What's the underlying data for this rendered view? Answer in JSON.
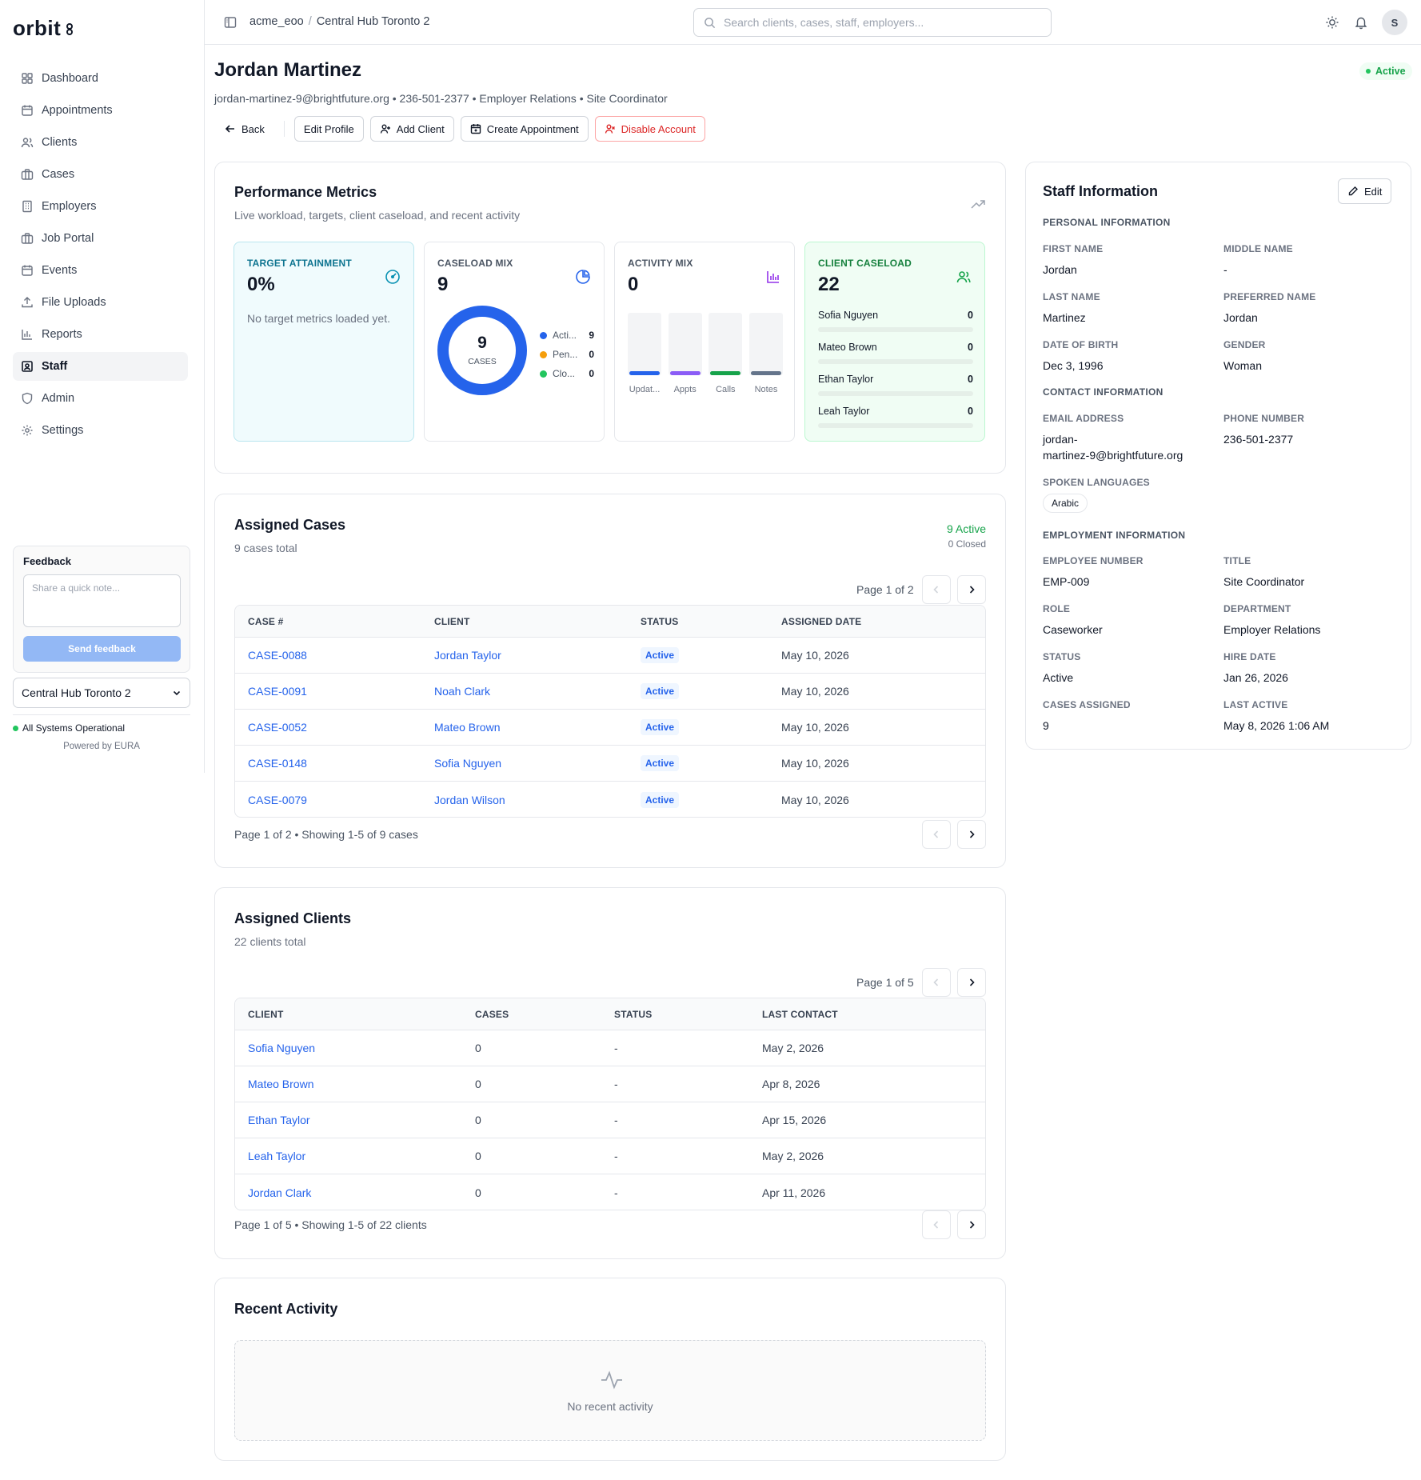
{
  "app": {
    "logo": "orbit"
  },
  "sidebar": {
    "items": [
      {
        "label": "Dashboard",
        "icon": "dashboard-icon"
      },
      {
        "label": "Appointments",
        "icon": "calendar-icon"
      },
      {
        "label": "Clients",
        "icon": "users-icon"
      },
      {
        "label": "Cases",
        "icon": "briefcase-icon"
      },
      {
        "label": "Employers",
        "icon": "building-icon"
      },
      {
        "label": "Job Portal",
        "icon": "briefcase-icon"
      },
      {
        "label": "Events",
        "icon": "calendar-icon"
      },
      {
        "label": "File Uploads",
        "icon": "upload-icon"
      },
      {
        "label": "Reports",
        "icon": "bar-chart-icon"
      },
      {
        "label": "Staff",
        "icon": "id-badge-icon",
        "active": true
      },
      {
        "label": "Admin",
        "icon": "shield-icon"
      },
      {
        "label": "Settings",
        "icon": "gear-icon"
      }
    ],
    "feedback": {
      "title": "Feedback",
      "placeholder": "Share a quick note...",
      "button": "Send feedback"
    },
    "hub": "Central Hub Toronto 2",
    "status": "All Systems Operational",
    "powered": "Powered by EURA"
  },
  "header": {
    "breadcrumb_org": "acme_eoo",
    "breadcrumb_sep": "/",
    "breadcrumb_hub": "Central Hub Toronto 2",
    "search_placeholder": "Search clients, cases, staff, employers...",
    "avatar": "S"
  },
  "profile": {
    "name": "Jordan Martinez",
    "subtitle": "jordan-martinez-9@brightfuture.org • 236-501-2377 • Employer Relations • Site Coordinator",
    "status": "Active",
    "actions": {
      "back": "Back",
      "edit": "Edit Profile",
      "add_client": "Add Client",
      "create_appt": "Create Appointment",
      "disable": "Disable Account"
    }
  },
  "metrics": {
    "title": "Performance Metrics",
    "subtitle": "Live workload, targets, client caseload, and recent activity",
    "target": {
      "label": "Target Attainment",
      "value": "0%",
      "empty": "No target metrics loaded yet."
    },
    "caseload": {
      "label": "Caseload Mix",
      "value": "9",
      "center_value": "9",
      "center_label": "CASES",
      "legend": [
        {
          "label": "Acti...",
          "value": "9",
          "color": "#2563eb"
        },
        {
          "label": "Pen...",
          "value": "0",
          "color": "#f59e0b"
        },
        {
          "label": "Clo...",
          "value": "0",
          "color": "#22c55e"
        }
      ]
    },
    "activity": {
      "label": "Activity Mix",
      "value": "0",
      "bars": [
        {
          "label": "Updat...",
          "color": "#2563eb"
        },
        {
          "label": "Appts",
          "color": "#8b5cf6"
        },
        {
          "label": "Calls",
          "color": "#16a34a"
        },
        {
          "label": "Notes",
          "color": "#64748b"
        }
      ]
    },
    "clients": {
      "label": "Client Caseload",
      "value": "22",
      "rows": [
        {
          "name": "Sofia Nguyen",
          "value": "0"
        },
        {
          "name": "Mateo Brown",
          "value": "0"
        },
        {
          "name": "Ethan Taylor",
          "value": "0"
        },
        {
          "name": "Leah Taylor",
          "value": "0"
        }
      ]
    }
  },
  "cases": {
    "title": "Assigned Cases",
    "subtitle": "9 cases total",
    "active": "9 Active",
    "closed": "0 Closed",
    "page": "Page 1 of 2",
    "columns": [
      "CASE #",
      "CLIENT",
      "STATUS",
      "ASSIGNED DATE"
    ],
    "rows": [
      {
        "case": "CASE-0088",
        "client": "Jordan Taylor",
        "status": "Active",
        "date": "May 10, 2026"
      },
      {
        "case": "CASE-0091",
        "client": "Noah Clark",
        "status": "Active",
        "date": "May 10, 2026"
      },
      {
        "case": "CASE-0052",
        "client": "Mateo Brown",
        "status": "Active",
        "date": "May 10, 2026"
      },
      {
        "case": "CASE-0148",
        "client": "Sofia Nguyen",
        "status": "Active",
        "date": "May 10, 2026"
      },
      {
        "case": "CASE-0079",
        "client": "Jordan Wilson",
        "status": "Active",
        "date": "May 10, 2026"
      }
    ],
    "footer": "Page 1 of 2 • Showing 1-5 of 9 cases"
  },
  "clients": {
    "title": "Assigned Clients",
    "subtitle": "22 clients total",
    "page": "Page 1 of 5",
    "columns": [
      "CLIENT",
      "CASES",
      "STATUS",
      "LAST CONTACT"
    ],
    "rows": [
      {
        "client": "Sofia Nguyen",
        "cases": "0",
        "status": "-",
        "last": "May 2, 2026"
      },
      {
        "client": "Mateo Brown",
        "cases": "0",
        "status": "-",
        "last": "Apr 8, 2026"
      },
      {
        "client": "Ethan Taylor",
        "cases": "0",
        "status": "-",
        "last": "Apr 15, 2026"
      },
      {
        "client": "Leah Taylor",
        "cases": "0",
        "status": "-",
        "last": "May 2, 2026"
      },
      {
        "client": "Jordan Clark",
        "cases": "0",
        "status": "-",
        "last": "Apr 11, 2026"
      }
    ],
    "footer": "Page 1 of 5 • Showing 1-5 of 22 clients"
  },
  "activity": {
    "title": "Recent Activity",
    "empty": "No recent activity"
  },
  "staff_info": {
    "title": "Staff Information",
    "edit": "Edit",
    "personal_heading": "Personal Information",
    "first_name_label": "First Name",
    "first_name": "Jordan",
    "middle_name_label": "Middle Name",
    "middle_name": "-",
    "last_name_label": "Last Name",
    "last_name": "Martinez",
    "preferred_name_label": "Preferred Name",
    "preferred_name": "Jordan",
    "dob_label": "Date of Birth",
    "dob": "Dec 3, 1996",
    "gender_label": "Gender",
    "gender": "Woman",
    "contact_heading": "Contact Information",
    "email_label": "Email Address",
    "email_line1": "jordan-",
    "email_line2": "martinez-9@brightfuture.org",
    "phone_label": "Phone Number",
    "phone": "236-501-2377",
    "languages_label": "Spoken Languages",
    "language": "Arabic",
    "employment_heading": "Employment Information",
    "emp_no_label": "Employee Number",
    "emp_no": "EMP-009",
    "title_label": "Title",
    "title_value": "Site Coordinator",
    "role_label": "Role",
    "role": "Caseworker",
    "department_label": "Department",
    "department": "Employer Relations",
    "status_label": "Status",
    "status": "Active",
    "hire_label": "Hire Date",
    "hire": "Jan 26, 2026",
    "cases_label": "Cases Assigned",
    "cases": "9",
    "last_active_label": "Last Active",
    "last_active": "May 8, 2026 1:06 AM"
  }
}
